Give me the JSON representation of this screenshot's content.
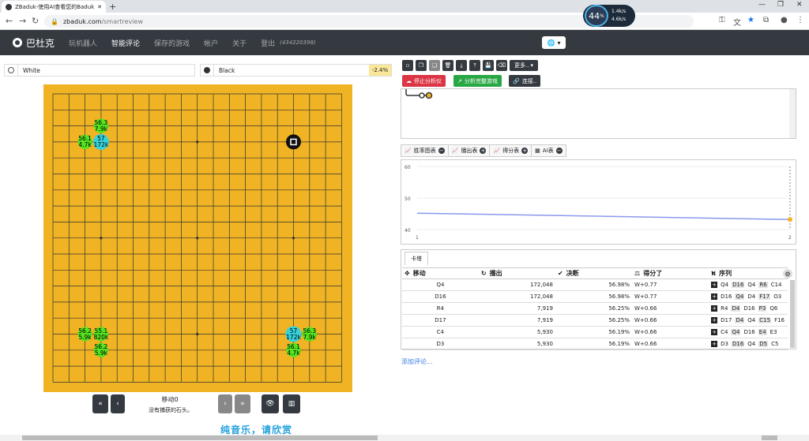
{
  "browser": {
    "tab_title": "ZBaduk-使用AI查看您的Baduk游戏",
    "url_domain": "zbaduk.com",
    "url_path": "/smartreview",
    "perf": {
      "percent": "44",
      "unit": "%",
      "up": "1.4k/s",
      "down": "4.6k/s"
    }
  },
  "nav": {
    "brand": "巴杜克",
    "items": [
      "玩机器人",
      "智能评论",
      "保存的游戏",
      "帐户",
      "关于",
      "登出"
    ],
    "active": "智能评论",
    "user_id": "(434220398)"
  },
  "players": {
    "white": {
      "name": "White"
    },
    "black": {
      "name": "Black",
      "winrate": "-2.4%"
    }
  },
  "candidates": [
    {
      "winrate": "56.3",
      "visits": "7.9k",
      "col": 3,
      "row": 2
    },
    {
      "winrate": "56.1",
      "visits": "4.7k",
      "col": 2,
      "row": 3
    },
    {
      "winrate": "57",
      "visits": "172k",
      "col": 3,
      "row": 3,
      "best": true
    },
    {
      "winrate": "56.2",
      "visits": "5.9k",
      "col": 2,
      "row": 15
    },
    {
      "winrate": "55.1",
      "visits": "820k",
      "col": 3,
      "row": 15
    },
    {
      "winrate": "56.2",
      "visits": "5.9k",
      "col": 3,
      "row": 16
    },
    {
      "winrate": "57",
      "visits": "172k",
      "col": 15,
      "row": 15,
      "best": true
    },
    {
      "winrate": "56.3",
      "visits": "7.9k",
      "col": 16,
      "row": 15
    },
    {
      "winrate": "56.1",
      "visits": "4.7k",
      "col": 15,
      "row": 16
    }
  ],
  "board_controls": {
    "move_label": "移动0",
    "move_sub": "没有捕获的石头。"
  },
  "toolbar": {
    "more_label": "更多..",
    "stop_label": "停止分析仪",
    "analyze_label": "分析完整游戏",
    "link_label": "连接.."
  },
  "graph_tabs": [
    "胜率图表",
    "播出表",
    "得分表",
    "AI表"
  ],
  "chart_data": {
    "type": "line",
    "x": [
      1,
      2
    ],
    "series": [
      {
        "values": [
          45.2,
          43.2
        ]
      }
    ],
    "ylim": [
      40,
      60
    ],
    "yticks": [
      "60",
      "50",
      "40"
    ],
    "xticks": [
      "1",
      "2"
    ],
    "line_color": "#8a99ee",
    "marker_color": "#f0b323"
  },
  "card": {
    "tab_label": "卡塔",
    "columns": [
      "移动",
      "播出",
      "决断",
      "得分了",
      "序列"
    ],
    "rows": [
      {
        "move": "Q4",
        "visits": "172,048",
        "winrate": "56.98%",
        "score": "W+0.77",
        "seq": [
          "Q4",
          "D16",
          "Q4",
          "R6",
          "C14"
        ]
      },
      {
        "move": "D16",
        "visits": "172,048",
        "winrate": "56.98%",
        "score": "W+0.77",
        "seq": [
          "D16",
          "Q4",
          "D4",
          "F17",
          "O3"
        ]
      },
      {
        "move": "R4",
        "visits": "7,919",
        "winrate": "56.25%",
        "score": "W+0.66",
        "seq": [
          "R4",
          "D4",
          "D16",
          "P3",
          "Q6"
        ]
      },
      {
        "move": "D17",
        "visits": "7,919",
        "winrate": "56.25%",
        "score": "W+0.66",
        "seq": [
          "D17",
          "D4",
          "Q4",
          "C15",
          "F16"
        ]
      },
      {
        "move": "C4",
        "visits": "5,930",
        "winrate": "56.19%",
        "score": "W+0.66",
        "seq": [
          "C4",
          "Q4",
          "D16",
          "E4",
          "E3"
        ]
      },
      {
        "move": "D3",
        "visits": "5,930",
        "winrate": "56.19%",
        "score": "W+0.66",
        "seq": [
          "D3",
          "D16",
          "Q4",
          "D5",
          "C5"
        ]
      }
    ]
  },
  "add_comment": "添加评论...",
  "overlay_text": "纯音乐，请欣赏"
}
